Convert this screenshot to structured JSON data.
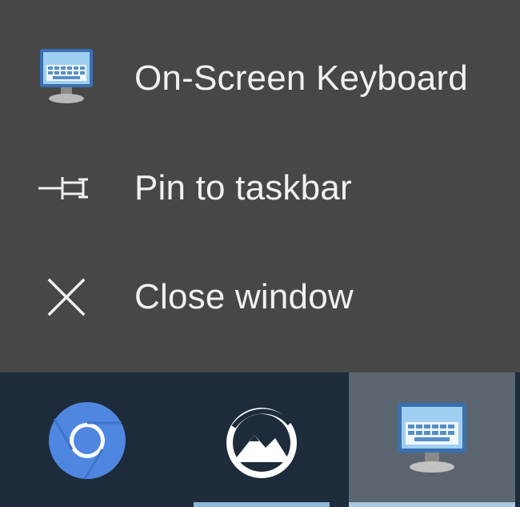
{
  "jumplist": {
    "items": [
      {
        "label": "On-Screen Keyboard",
        "icon": "on-screen-keyboard-icon"
      },
      {
        "label": "Pin to taskbar",
        "icon": "pin-icon"
      },
      {
        "label": "Close window",
        "icon": "close-icon"
      }
    ]
  },
  "taskbar": {
    "buttons": [
      {
        "icon": "chromium-browser-icon",
        "running": false,
        "active": false
      },
      {
        "icon": "mountain-app-icon",
        "running": true,
        "active": false
      },
      {
        "icon": "on-screen-keyboard-icon",
        "running": true,
        "active": true
      }
    ]
  },
  "colors": {
    "menu_background": "#474747",
    "menu_text": "#f1f1f1",
    "taskbar_background": "#1d2b3a",
    "active_button_background": "#5c6670",
    "running_indicator": "#8fb7d9"
  }
}
